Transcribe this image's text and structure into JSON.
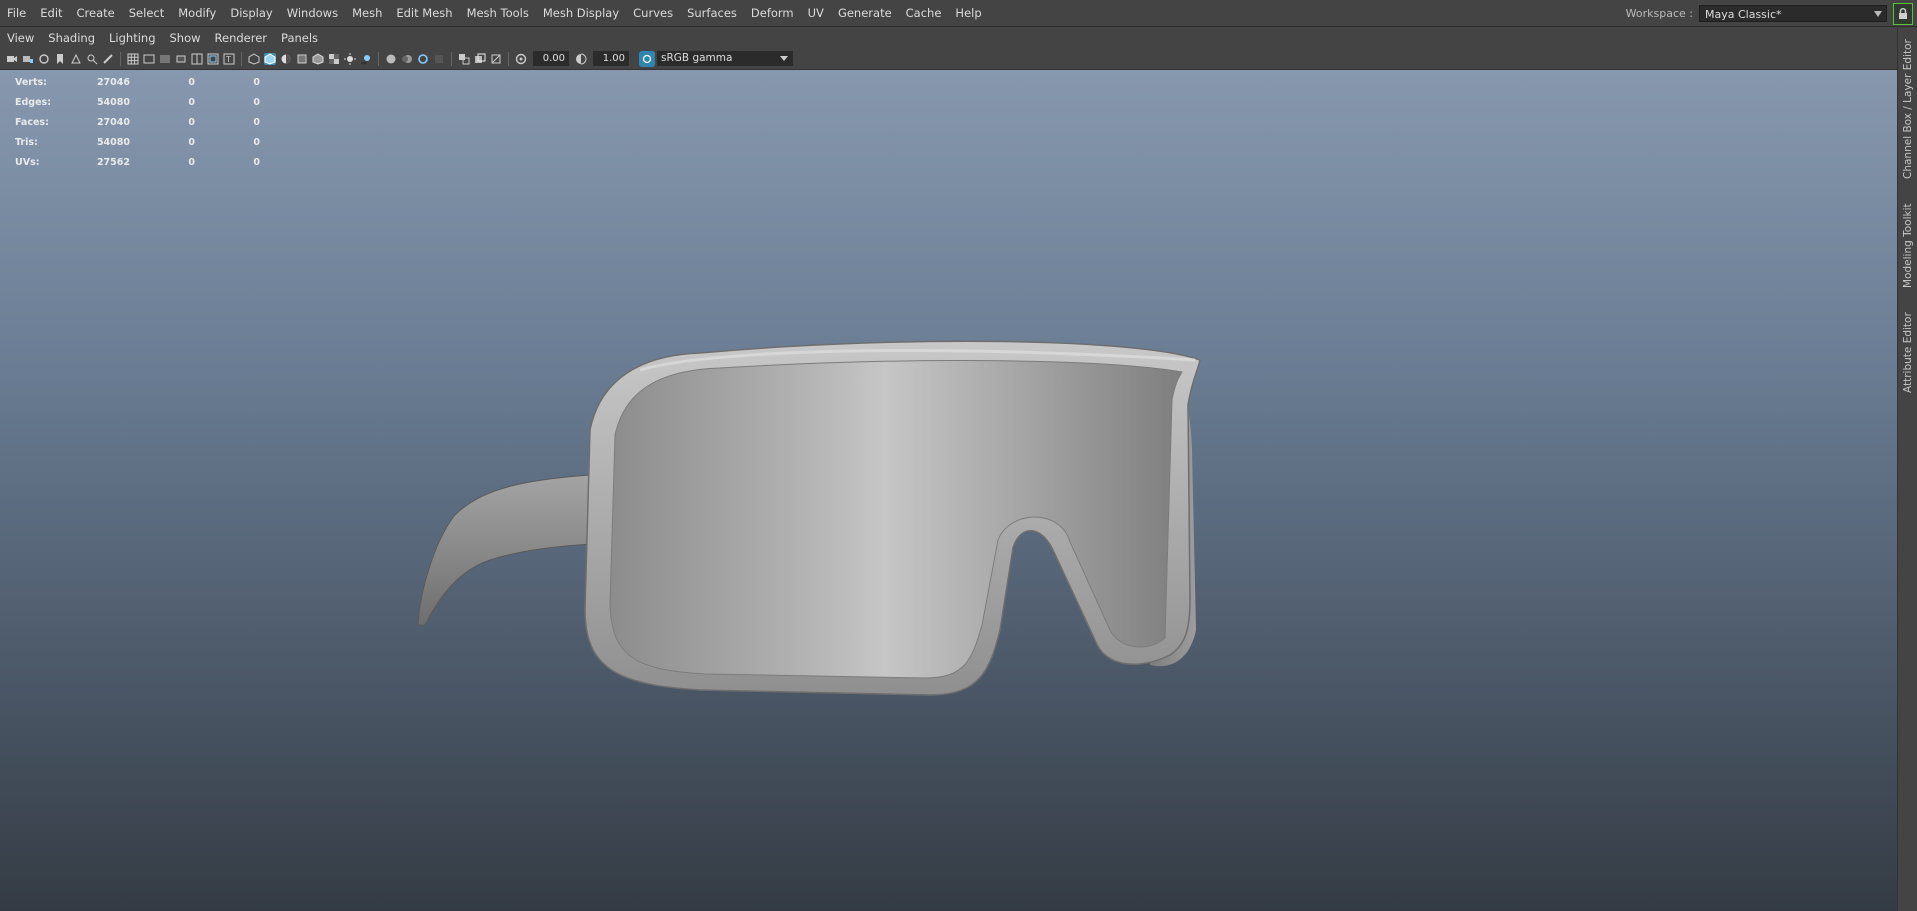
{
  "menubar": {
    "items": [
      "File",
      "Edit",
      "Create",
      "Select",
      "Modify",
      "Display",
      "Windows",
      "Mesh",
      "Edit Mesh",
      "Mesh Tools",
      "Mesh Display",
      "Curves",
      "Surfaces",
      "Deform",
      "UV",
      "Generate",
      "Cache",
      "Help"
    ]
  },
  "workspace": {
    "label": "Workspace :",
    "value": "Maya Classic*"
  },
  "panel_menu": {
    "items": [
      "View",
      "Shading",
      "Lighting",
      "Show",
      "Renderer",
      "Panels"
    ]
  },
  "toolbar": {
    "exposure": "0.00",
    "gamma": "1.00",
    "color_space": "sRGB gamma"
  },
  "hud": {
    "rows": [
      {
        "label": "Verts:",
        "v1": "27046",
        "v2": "0",
        "v3": "0"
      },
      {
        "label": "Edges:",
        "v1": "54080",
        "v2": "0",
        "v3": "0"
      },
      {
        "label": "Faces:",
        "v1": "27040",
        "v2": "0",
        "v3": "0"
      },
      {
        "label": "Tris:",
        "v1": "54080",
        "v2": "0",
        "v3": "0"
      },
      {
        "label": "UVs:",
        "v1": "27562",
        "v2": "0",
        "v3": "0"
      }
    ]
  },
  "side_tabs": [
    "Channel Box / Layer Editor",
    "Modeling Toolkit",
    "Attribute Editor"
  ]
}
